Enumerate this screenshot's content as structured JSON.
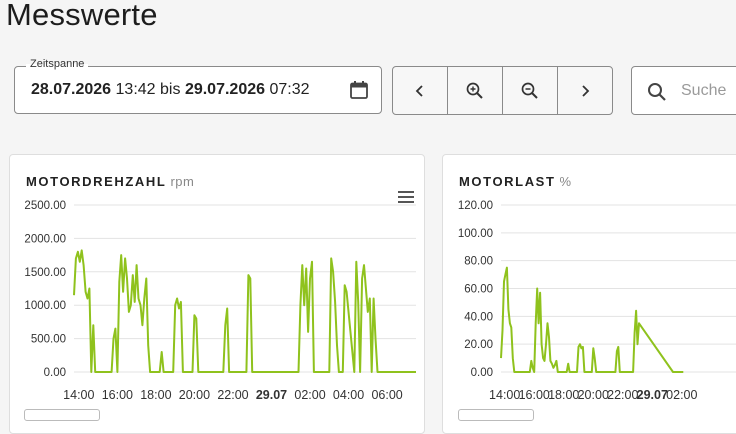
{
  "page": {
    "title": "Messwerte"
  },
  "range": {
    "legend": "Zeitspanne",
    "from_date": "28.07.2026",
    "from_time": "13:42",
    "separator": "bis",
    "to_date": "29.07.2026",
    "to_time": "07:32"
  },
  "nav": {
    "icons": [
      "chevron-left-icon",
      "zoom-in-icon",
      "zoom-out-icon",
      "chevron-right-icon"
    ]
  },
  "search": {
    "placeholder": "Suche"
  },
  "colors": {
    "series": "#8fc21d",
    "grid": "#e3e3e3",
    "axis_text": "#333333"
  },
  "cards": [
    {
      "title": "MOTORDREHZAHL",
      "unit": "rpm"
    },
    {
      "title": "MOTORLAST",
      "unit": "%"
    }
  ],
  "chart_data": [
    {
      "type": "line",
      "title": "MOTORDREHZAHL",
      "unit": "rpm",
      "ylim": [
        0,
        2500
      ],
      "yticks": [
        "2500.00",
        "2000.00",
        "1500.00",
        "1000.00",
        "500.00",
        "0.00"
      ],
      "xlim": [
        13.75,
        31.5
      ],
      "xticks": [
        {
          "x": 14,
          "label": "14:00",
          "bold": false
        },
        {
          "x": 16,
          "label": "16:00",
          "bold": false
        },
        {
          "x": 18,
          "label": "18:00",
          "bold": false
        },
        {
          "x": 20,
          "label": "20:00",
          "bold": false
        },
        {
          "x": 22,
          "label": "22:00",
          "bold": false
        },
        {
          "x": 24,
          "label": "29.07",
          "bold": true
        },
        {
          "x": 26,
          "label": "02:00",
          "bold": false
        },
        {
          "x": 28,
          "label": "04:00",
          "bold": false
        },
        {
          "x": 30,
          "label": "06:00",
          "bold": false
        }
      ],
      "grid": true,
      "x": [
        13.75,
        13.85,
        13.95,
        14.05,
        14.15,
        14.25,
        14.35,
        14.45,
        14.55,
        14.65,
        14.75,
        14.85,
        15.7,
        15.8,
        15.9,
        16.0,
        16.1,
        16.2,
        16.3,
        16.4,
        16.5,
        16.6,
        16.7,
        16.8,
        16.9,
        17.0,
        17.1,
        17.2,
        17.3,
        17.4,
        17.5,
        17.6,
        17.7,
        17.8,
        18.2,
        18.3,
        18.4,
        18.9,
        19.0,
        19.1,
        19.2,
        19.3,
        19.4,
        19.5,
        19.9,
        20.0,
        20.1,
        20.2,
        21.5,
        21.6,
        21.7,
        21.8,
        22.7,
        22.8,
        22.9,
        23.0,
        23.1,
        25.4,
        25.5,
        25.6,
        25.7,
        25.8,
        25.9,
        26.0,
        26.1,
        26.2,
        26.3,
        26.4,
        26.5,
        27.0,
        27.1,
        27.2,
        27.3,
        27.4,
        27.5,
        27.6,
        27.7,
        27.8,
        27.9,
        28.3,
        28.4,
        28.5,
        28.6,
        28.7,
        28.8,
        28.9,
        29.0,
        29.1,
        29.2,
        29.3,
        29.4,
        29.5,
        29.6,
        29.7,
        29.8,
        29.9,
        30.0,
        30.1,
        30.2,
        30.3,
        30.4,
        30.5,
        31.5
      ],
      "values": [
        1150,
        1700,
        1800,
        1650,
        1820,
        1600,
        1200,
        1100,
        1250,
        0,
        700,
        0,
        0,
        500,
        650,
        0,
        1350,
        1750,
        1200,
        1700,
        1400,
        900,
        1000,
        1450,
        1050,
        1600,
        1100,
        1000,
        700,
        1100,
        1400,
        400,
        0,
        0,
        0,
        300,
        0,
        0,
        1000,
        1100,
        950,
        1050,
        0,
        0,
        0,
        850,
        800,
        0,
        0,
        700,
        950,
        0,
        0,
        1450,
        1400,
        0,
        0,
        0,
        1000,
        1600,
        1000,
        1550,
        600,
        1400,
        1650,
        0,
        0,
        0,
        0,
        0,
        1700,
        1500,
        1050,
        400,
        0,
        0,
        0,
        1300,
        1200,
        0,
        1650,
        1050,
        0,
        1400,
        1600,
        1250,
        900,
        1100,
        0,
        1100,
        500,
        0,
        0,
        0,
        0,
        0,
        0,
        0,
        0,
        0,
        0,
        0,
        0
      ]
    },
    {
      "type": "line",
      "title": "MOTORLAST",
      "unit": "%",
      "ylim": [
        0,
        120
      ],
      "yticks": [
        "120.00",
        "100.00",
        "80.00",
        "60.00",
        "40.00",
        "20.00",
        "0.00"
      ],
      "xlim": [
        13.75,
        31.5
      ],
      "xticks": [
        {
          "x": 14,
          "label": "14:00",
          "bold": false
        },
        {
          "x": 16,
          "label": "16:00",
          "bold": false
        },
        {
          "x": 18,
          "label": "18:00",
          "bold": false
        },
        {
          "x": 20,
          "label": "20:00",
          "bold": false
        },
        {
          "x": 22,
          "label": "22:00",
          "bold": false
        },
        {
          "x": 24,
          "label": "29.07",
          "bold": true
        },
        {
          "x": 26,
          "label": "02:00",
          "bold": false
        }
      ],
      "grid": true,
      "x": [
        13.75,
        13.85,
        13.95,
        14.05,
        14.15,
        14.25,
        14.35,
        14.45,
        14.55,
        14.65,
        14.75,
        14.85,
        15.7,
        15.8,
        15.9,
        16.0,
        16.1,
        16.2,
        16.3,
        16.4,
        16.5,
        16.6,
        16.7,
        16.8,
        16.9,
        17.0,
        17.1,
        17.2,
        17.3,
        17.4,
        17.5,
        17.6,
        17.7,
        17.8,
        18.2,
        18.3,
        18.4,
        18.9,
        19.0,
        19.1,
        19.2,
        19.3,
        19.4,
        19.5,
        19.9,
        20.0,
        20.1,
        20.2,
        21.5,
        21.6,
        21.7,
        21.8,
        22.7,
        22.8,
        22.9,
        23.0,
        23.1,
        25.4,
        25.5,
        25.6,
        25.7,
        25.8,
        25.9,
        26.0,
        26.1
      ],
      "values": [
        10,
        30,
        65,
        70,
        75,
        45,
        35,
        32,
        10,
        0,
        0,
        0,
        0,
        8,
        3,
        0,
        35,
        60,
        35,
        57,
        20,
        10,
        8,
        20,
        35,
        25,
        8,
        6,
        3,
        5,
        8,
        0,
        0,
        0,
        0,
        6,
        0,
        0,
        18,
        20,
        17,
        18,
        0,
        0,
        0,
        17,
        10,
        0,
        0,
        15,
        18,
        0,
        0,
        28,
        44,
        20,
        35,
        0,
        0,
        0,
        0,
        0,
        0,
        0,
        0
      ]
    }
  ]
}
